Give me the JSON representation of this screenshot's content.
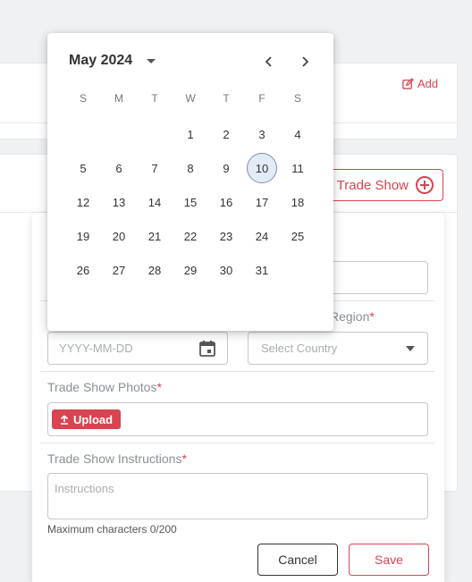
{
  "background": {
    "add_label": "Add",
    "add_trade_show_label": "Trade Show"
  },
  "form": {
    "region_label_partial": "Region",
    "date_placeholder": "YYYY-MM-DD",
    "country_placeholder": "Select Country",
    "photos_label": "Trade Show Photos",
    "upload_label": "Upload",
    "instructions_label": "Trade Show Instructions",
    "instructions_placeholder": "Instructions",
    "max_chars": "Maximum characters 0/200",
    "cancel_label": "Cancel",
    "save_label": "Save",
    "required_mark": "*"
  },
  "calendar": {
    "month_year": "May 2024",
    "weekdays": [
      "S",
      "M",
      "T",
      "W",
      "T",
      "F",
      "S"
    ],
    "leading_blanks": 3,
    "days_in_month": 31,
    "selected_day": 10
  },
  "colors": {
    "accent": "#d64550",
    "selected_day_bg": "#e3ebf6"
  },
  "icons": {
    "add": "edit-square-icon",
    "add_trade_show": "plus-circle-icon",
    "date": "calendar-icon",
    "country": "caret-down-icon",
    "upload": "upload-arrow-icon",
    "month_dropdown": "caret-down-icon",
    "prev": "chevron-left-icon",
    "next": "chevron-right-icon"
  }
}
